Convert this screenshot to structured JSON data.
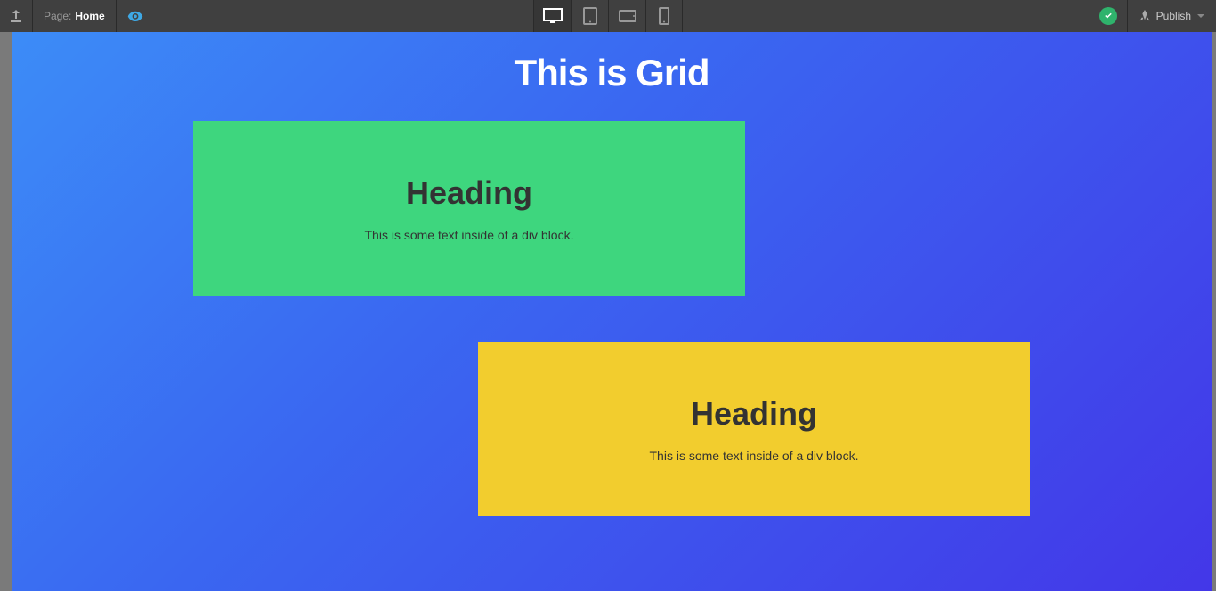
{
  "topbar": {
    "page_label": "Page:",
    "page_name": "Home",
    "publish_label": "Publish"
  },
  "canvas": {
    "title": "This is Grid",
    "cards": [
      {
        "heading": "Heading",
        "text": "This is some text inside of a div block."
      },
      {
        "heading": "Heading",
        "text": "This is some text inside of a div block."
      }
    ]
  }
}
